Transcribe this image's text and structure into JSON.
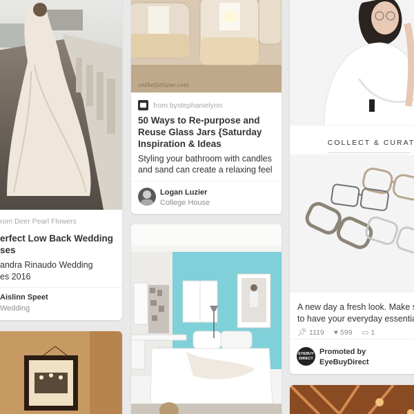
{
  "cards": {
    "wedding": {
      "source": "rom Deer Pearl Flowers",
      "title_lines": [
        "erfect Low Back Wedding",
        "ses"
      ],
      "desc_lines": [
        "andra Rinaudo Wedding",
        "es 2016"
      ],
      "pinner_name": "Aislinn Speet",
      "pinner_board": "Wedding"
    },
    "jars": {
      "watermark": "onthefairlane.com",
      "source": "from bystephanielynn",
      "title_lines": [
        "50 Ways to Re-purpose and",
        "Reuse Glass Jars {Saturday",
        "Inspiration & Ideas"
      ],
      "desc_lines": [
        "Styling your bathroom with candles",
        "and sand can create a relaxing feel"
      ],
      "pinner_name": "Logan Luzier",
      "pinner_board": "College House"
    },
    "glasses": {
      "banner": "COLLECT & CURATE",
      "desc_lines": [
        "A new day a fresh look. Make su",
        "to have your everyday essential"
      ],
      "repins": "1119",
      "likes": "599",
      "comments": "1",
      "promoted_label": "Promoted by",
      "promoter": "EyeBuyDirect",
      "promoter_logo": "EYEBUY DIRECT"
    }
  },
  "colors": {
    "background": "#e9e9e9",
    "card": "#ffffff",
    "text": "#333333",
    "muted": "#8e8e8e",
    "wall_teal": "#7fd0d8"
  }
}
